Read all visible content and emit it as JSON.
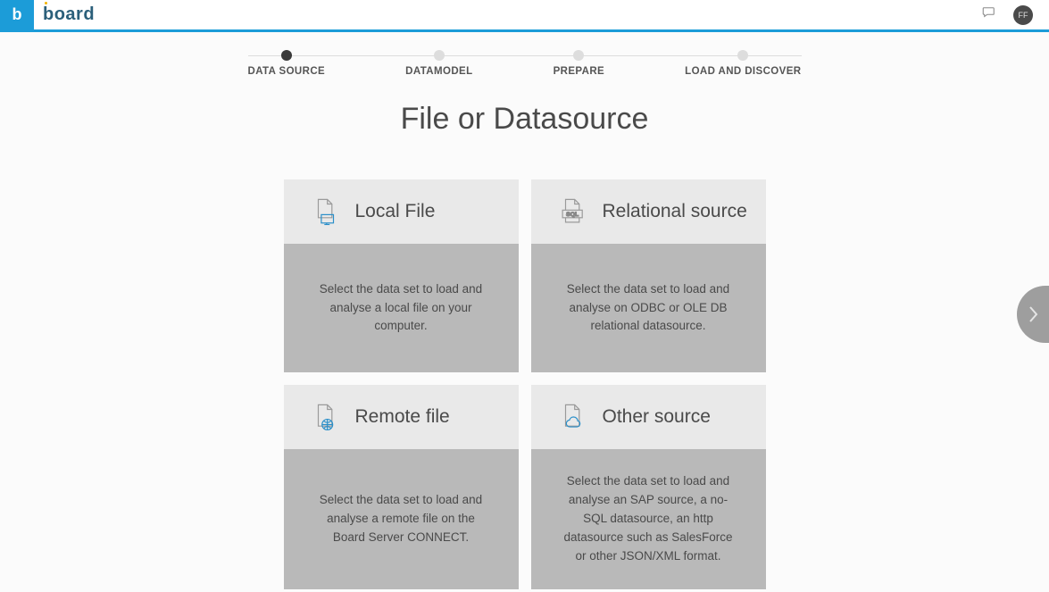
{
  "header": {
    "brand_b": "b",
    "brand_logo_text": "board",
    "avatar_initials": "FF"
  },
  "stepper": {
    "steps": [
      {
        "label": "DATA SOURCE",
        "active": true
      },
      {
        "label": "DATAMODEL",
        "active": false
      },
      {
        "label": "PREPARE",
        "active": false
      },
      {
        "label": "LOAD AND DISCOVER",
        "active": false
      }
    ]
  },
  "page": {
    "heading": "File or Datasource"
  },
  "cards": [
    {
      "id": "local-file",
      "title": "Local File",
      "desc": "Select the data set to load and analyse a local file on your computer."
    },
    {
      "id": "relational-source",
      "title": "Relational source",
      "desc": "Select the data set to load and analyse on ODBC or OLE DB relational datasource."
    },
    {
      "id": "remote-file",
      "title": "Remote file",
      "desc": "Select the data set to load and analyse a remote file on the Board Server CONNECT."
    },
    {
      "id": "other-source",
      "title": "Other source",
      "desc": "Select the data set to load and analyse an SAP source, a no-SQL datasource, an http datasource such as SalesForce or other JSON/XML format."
    }
  ],
  "icons": {
    "sql_text": "SQL"
  }
}
